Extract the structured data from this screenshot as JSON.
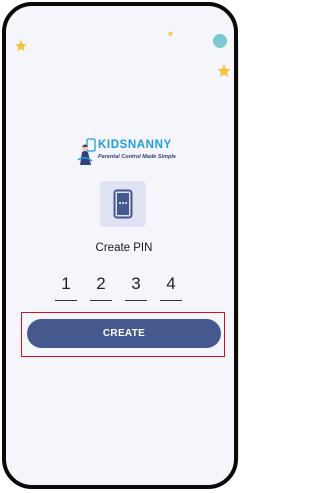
{
  "logo": {
    "brand": "KIDSNANNY",
    "tagline": "Parental Control Made Simple"
  },
  "pin_screen": {
    "title": "Create PIN",
    "digits": [
      "1",
      "2",
      "3",
      "4"
    ],
    "button_label": "CREATE"
  },
  "icons": {
    "pin_icon": "phone-keypad-icon",
    "decorations": [
      "star-icon",
      "star-icon",
      "star-icon",
      "dot"
    ]
  },
  "colors": {
    "button": "#46598f",
    "highlight": "#d0121e",
    "brand": "#1d9fd9",
    "star": "#f5c43c",
    "dot": "#7ec8d1"
  }
}
